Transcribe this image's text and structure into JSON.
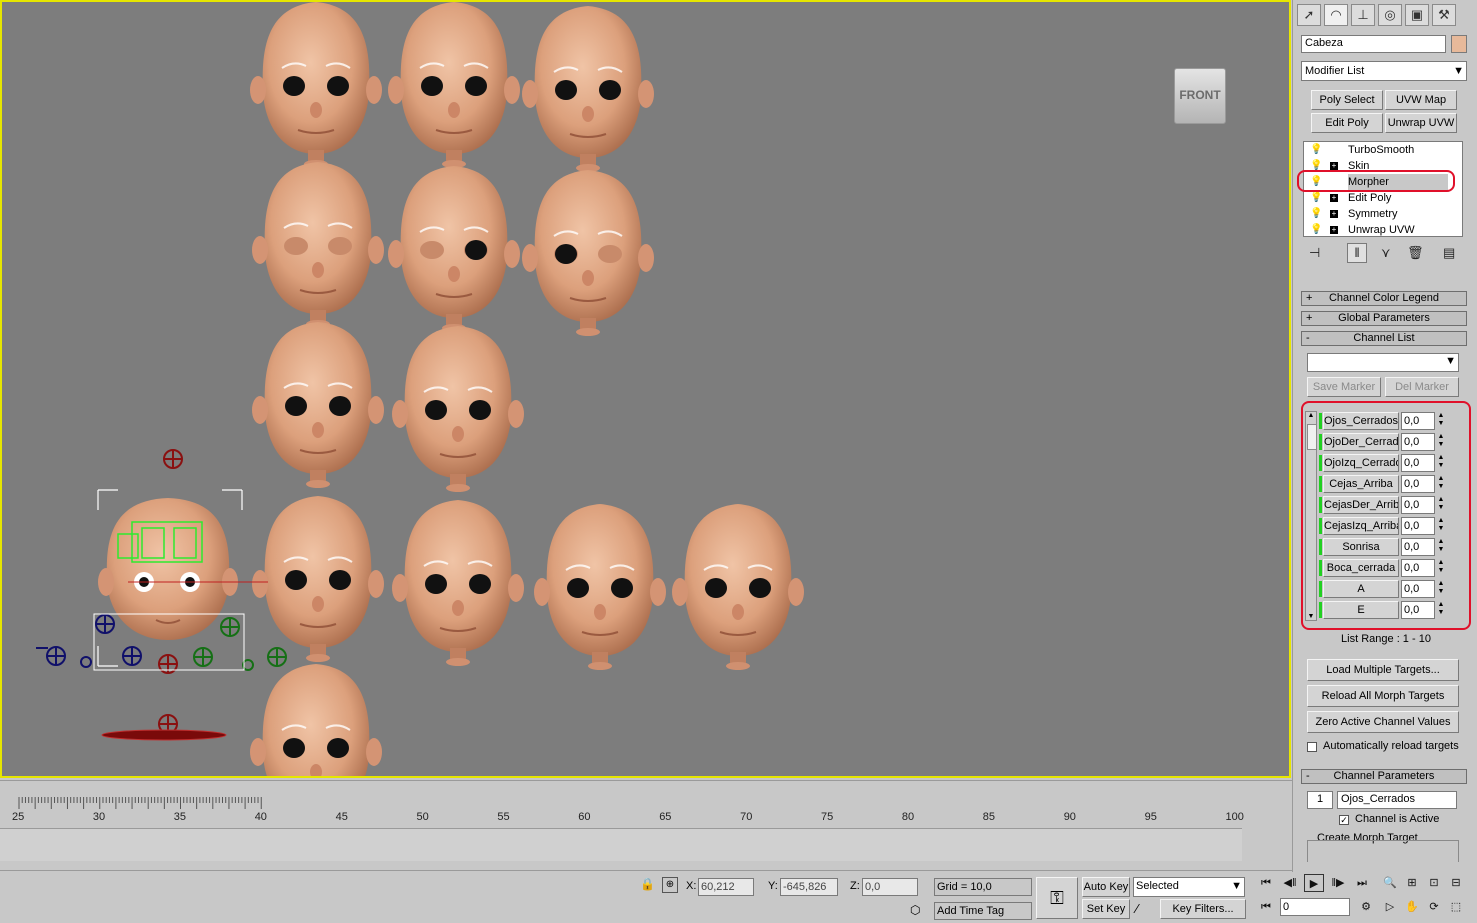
{
  "viewport": {
    "viewcube_label": "FRONT"
  },
  "panel": {
    "tabs": [
      "pointer-icon",
      "modify-icon",
      "hierarchy-icon",
      "motion-icon",
      "display-icon",
      "utilities-icon"
    ],
    "object_name": "Cabeza",
    "object_color": "#e7b99a",
    "modifier_list": "Modifier List",
    "buttons": {
      "poly_select": "Poly Select",
      "uvw_map": "UVW Map",
      "edit_poly": "Edit Poly",
      "unwrap_uvw": "Unwrap UVW"
    },
    "stack": [
      {
        "label": "TurboSmooth",
        "expand": false
      },
      {
        "label": "Skin",
        "expand": true
      },
      {
        "label": "Morpher",
        "expand": false
      },
      {
        "label": "Edit Poly",
        "expand": true
      },
      {
        "label": "Symmetry",
        "expand": true
      },
      {
        "label": "Unwrap UVW",
        "expand": true
      }
    ],
    "rollouts": {
      "color_legend": "Channel Color Legend",
      "global_params": "Global Parameters",
      "channel_list": "Channel List",
      "channel_params": "Channel Parameters",
      "plus": "+",
      "minus": "-"
    },
    "markers": {
      "save": "Save Marker",
      "delete": "Del Marker"
    },
    "channels": [
      {
        "name": "Ojos_Cerrados",
        "value": "0,0"
      },
      {
        "name": "OjoDer_Cerrado",
        "value": "0,0"
      },
      {
        "name": "OjoIzq_Cerrado",
        "value": "0,0"
      },
      {
        "name": "Cejas_Arriba",
        "value": "0,0"
      },
      {
        "name": "CejasDer_Arriba",
        "value": "0,0"
      },
      {
        "name": "CejasIzq_Arriba",
        "value": "0,0"
      },
      {
        "name": "Sonrisa",
        "value": "0,0"
      },
      {
        "name": "Boca_cerrada",
        "value": "0,0"
      },
      {
        "name": "A",
        "value": "0,0"
      },
      {
        "name": "E",
        "value": "0,0"
      }
    ],
    "list_range": "List Range :     1 - 10",
    "actions": {
      "load_multiple": "Load Multiple Targets...",
      "reload_all": "Reload All Morph Targets",
      "zero_active": "Zero Active Channel Values",
      "auto_reload": "Automatically reload targets"
    },
    "channel_params": {
      "number": "1",
      "name": "Ojos_Cerrados",
      "active_label": "Channel is Active",
      "create_target": "Create Morph Target"
    }
  },
  "timeline": {
    "labels": [
      "25",
      "30",
      "35",
      "40",
      "45",
      "50",
      "55",
      "60",
      "65",
      "70",
      "75",
      "80",
      "85",
      "90",
      "95",
      "100"
    ]
  },
  "status": {
    "x_label": "X:",
    "x_value": "60,212",
    "y_label": "Y:",
    "y_value": "-645,826",
    "z_label": "Z:",
    "z_value": "0,0",
    "grid": "Grid = 10,0",
    "add_time_tag": "Add Time Tag",
    "auto_key": "Auto Key",
    "set_key": "Set Key",
    "selected": "Selected",
    "key_filters": "Key Filters...",
    "frame": "0"
  }
}
